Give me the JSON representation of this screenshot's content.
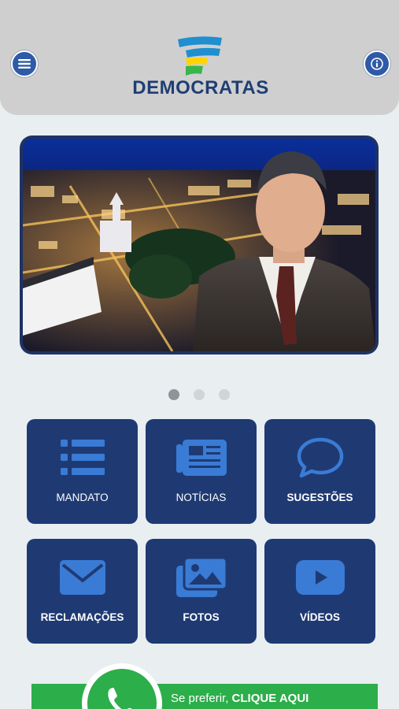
{
  "header": {
    "logo_text": "DEMOCRATAS",
    "menu_icon": "menu-icon",
    "info_icon": "info-icon"
  },
  "banner": {
    "slides": 3,
    "active_slide": 1
  },
  "tiles": [
    {
      "label": "MANDATO",
      "icon": "list-icon"
    },
    {
      "label": "NOTÍCIAS",
      "icon": "newspaper-icon"
    },
    {
      "label": "SUGESTÕES",
      "icon": "speech-bubble-icon"
    },
    {
      "label": "RECLAMAÇÕES",
      "icon": "envelope-icon"
    },
    {
      "label": "FOTOS",
      "icon": "photos-icon"
    },
    {
      "label": "VÍDEOS",
      "icon": "video-play-icon"
    }
  ],
  "whatsapp": {
    "prefix": "Se preferir, ",
    "cta": "CLIQUE AQUI",
    "icon": "whatsapp-icon"
  },
  "colors": {
    "tile_bg": "#1f3a73",
    "icon_blue": "#3a7bd5",
    "header_bg": "#cfcfcf",
    "whatsapp_green": "#2cae4a"
  }
}
